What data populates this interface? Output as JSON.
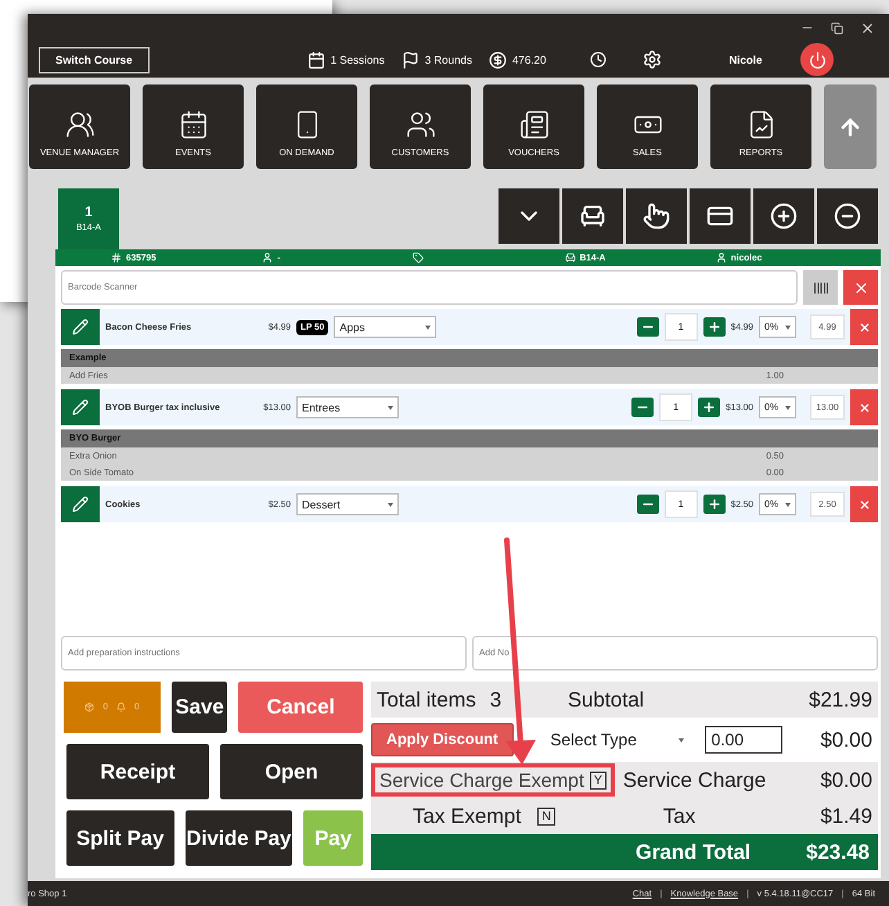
{
  "header": {
    "switch_course": "Switch Course",
    "stats": [
      {
        "kind": "calendar",
        "text": "1 Sessions"
      },
      {
        "kind": "golf",
        "text": "3 Rounds"
      },
      {
        "kind": "dollar",
        "text": "476.20"
      }
    ],
    "user": "Nicole"
  },
  "nav": [
    {
      "kind": "venue",
      "label": "VENUE MANAGER"
    },
    {
      "kind": "events",
      "label": "EVENTS"
    },
    {
      "kind": "phone",
      "label": "ON DEMAND"
    },
    {
      "kind": "customers",
      "label": "CUSTOMERS"
    },
    {
      "kind": "vouchers",
      "label": "VOUCHERS"
    },
    {
      "kind": "sales",
      "label": "SALES"
    },
    {
      "kind": "reports",
      "label": "REPORTS"
    }
  ],
  "order_tab": {
    "number": "1",
    "table": "B14-A",
    "selected": true
  },
  "info_bar": [
    {
      "kind": "hash",
      "text": "635795"
    },
    {
      "kind": "person",
      "text": "-"
    },
    {
      "kind": "tag"
    },
    {
      "kind": "table",
      "text": "B14-A"
    },
    {
      "kind": "person",
      "text": "nicolec"
    }
  ],
  "barcode": {
    "placeholder": "Barcode Scanner"
  },
  "items": [
    {
      "name": "Bacon Cheese Fries",
      "price": "$4.99",
      "badge": "LP 50",
      "category": "Apps",
      "quantity": "1",
      "line_price": "$4.99",
      "discount": "0%",
      "total": "4.99",
      "modifier_group": "Example",
      "modifiers": [
        {
          "text": "Add Fries",
          "price": "1.00"
        }
      ]
    },
    {
      "name": "BYOB Burger tax inclusive",
      "price": "$13.00",
      "category": "Entrees",
      "quantity": "1",
      "line_price": "$13.00",
      "discount": "0%",
      "total": "13.00",
      "modifier_group": "BYO Burger",
      "modifiers": [
        {
          "text": "Extra Onion",
          "price": "0.50"
        },
        {
          "text": "On Side Tomato",
          "price": "0.00"
        }
      ]
    },
    {
      "name": "Cookies",
      "price": "$2.50",
      "category": "Dessert",
      "quantity": "1",
      "line_price": "$2.50",
      "discount": "0%",
      "total": "2.50"
    }
  ],
  "notes": {
    "preparation_placeholder": "Add preparation instructions",
    "notes_placeholder": "Add No"
  },
  "counters": [
    "0",
    "0"
  ],
  "actions": [
    [
      {
        "kind": "dark",
        "label": "Save"
      },
      {
        "kind": "red",
        "label": "Cancel"
      }
    ],
    [
      {
        "kind": "dark",
        "label": "Receipt"
      },
      {
        "kind": "dark",
        "label": "Open"
      }
    ],
    [
      {
        "kind": "dark",
        "label": "Split Pay"
      },
      {
        "kind": "dark",
        "label": "Divide Pay"
      },
      {
        "kind": "green",
        "label": "Pay"
      }
    ]
  ],
  "totals": {
    "items_label": "Total items",
    "items_count": "3",
    "subtotal_label": "Subtotal",
    "subtotal": "$21.99",
    "discount_button": "Apply Discount",
    "discount_type": "Select Type",
    "discount_value": "0.00",
    "discount_amount": "$0.00",
    "service_exempt_label": "Service Charge Exempt",
    "service_exempt": "Y",
    "service_label": "Service Charge",
    "service": "$0.00",
    "tax_exempt_label": "Tax Exempt",
    "tax_exempt": "N",
    "tax_label": "Tax",
    "tax": "$1.49",
    "grand_label": "Grand Total",
    "grand": "$23.48"
  },
  "status_bar": {
    "location": "ro Shop 1",
    "links": [
      "Chat",
      "Knowledge Base"
    ],
    "separators": [
      "|",
      "|",
      "|"
    ],
    "version": "v 5.4.18.11@CC17",
    "bits": "64 Bit"
  }
}
